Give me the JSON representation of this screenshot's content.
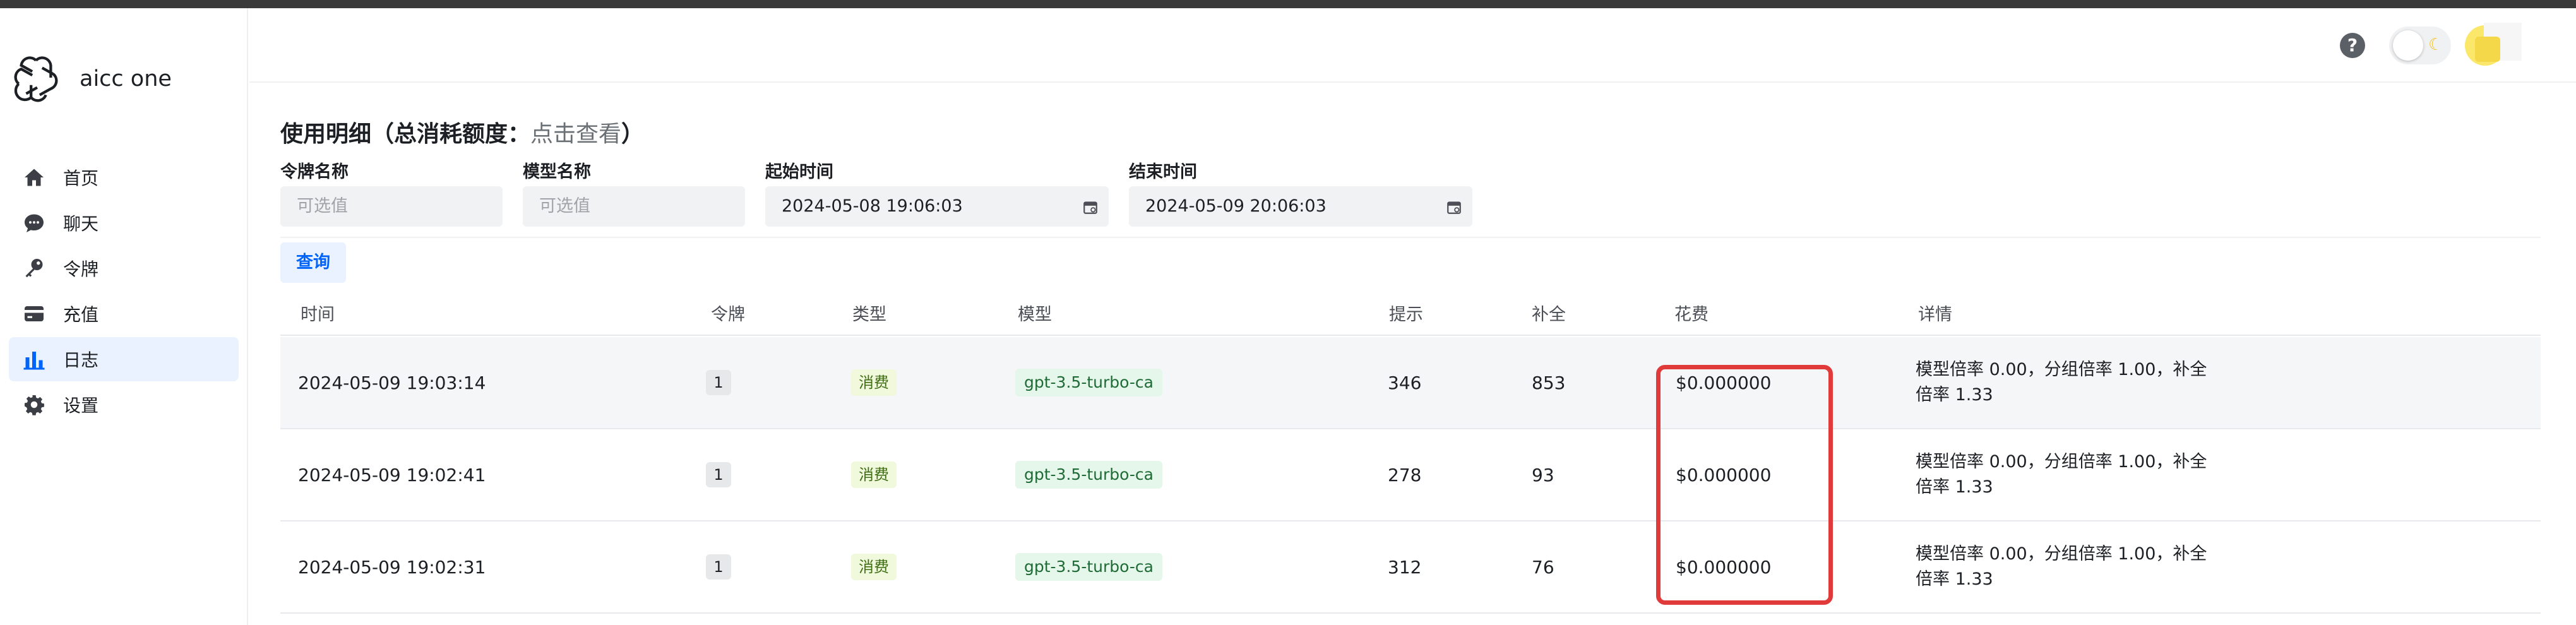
{
  "app": {
    "name": "aicc one"
  },
  "sidebar": {
    "items": [
      {
        "label": "首页",
        "icon": "home-icon",
        "active": false
      },
      {
        "label": "聊天",
        "icon": "chat-icon",
        "active": false
      },
      {
        "label": "令牌",
        "icon": "key-icon",
        "active": false
      },
      {
        "label": "充值",
        "icon": "credit-card-icon",
        "active": false
      },
      {
        "label": "日志",
        "icon": "bar-chart-icon",
        "active": true
      },
      {
        "label": "设置",
        "icon": "gear-icon",
        "active": false
      }
    ]
  },
  "header": {
    "help_label": "?",
    "theme_icon": "moon-icon"
  },
  "page": {
    "title": "使用明细（总消耗额度：",
    "title_link": "点击查看",
    "title_end": "）"
  },
  "filters": {
    "token_label": "令牌名称",
    "token_placeholder": "可选值",
    "model_label": "模型名称",
    "model_placeholder": "可选值",
    "start_label": "起始时间",
    "start_value": "2024-05-08 19:06:03",
    "end_label": "结束时间",
    "end_value": "2024-05-09 20:06:03",
    "query_label": "查询"
  },
  "table": {
    "columns": [
      "时间",
      "令牌",
      "类型",
      "模型",
      "提示",
      "补全",
      "花费",
      "详情"
    ],
    "rows": [
      {
        "time": "2024-05-09 19:03:14",
        "token": "1",
        "type": "消费",
        "model": "gpt-3.5-turbo-ca",
        "prompt": "346",
        "completion": "853",
        "cost": "$0.000000",
        "detail1": "模型倍率 0.00，分组倍率 1.00，补全",
        "detail2": "倍率 1.33"
      },
      {
        "time": "2024-05-09 19:02:41",
        "token": "1",
        "type": "消费",
        "model": "gpt-3.5-turbo-ca",
        "prompt": "278",
        "completion": "93",
        "cost": "$0.000000",
        "detail1": "模型倍率 0.00，分组倍率 1.00，补全",
        "detail2": "倍率 1.33"
      },
      {
        "time": "2024-05-09 19:02:31",
        "token": "1",
        "type": "消费",
        "model": "gpt-3.5-turbo-ca",
        "prompt": "312",
        "completion": "76",
        "cost": "$0.000000",
        "detail1": "模型倍率 0.00，分组倍率 1.00，补全",
        "detail2": "倍率 1.33"
      }
    ]
  },
  "colors": {
    "accent": "#0064fa",
    "highlight_box": "#e03a3a",
    "active_nav_bg": "#eaf2ff"
  }
}
